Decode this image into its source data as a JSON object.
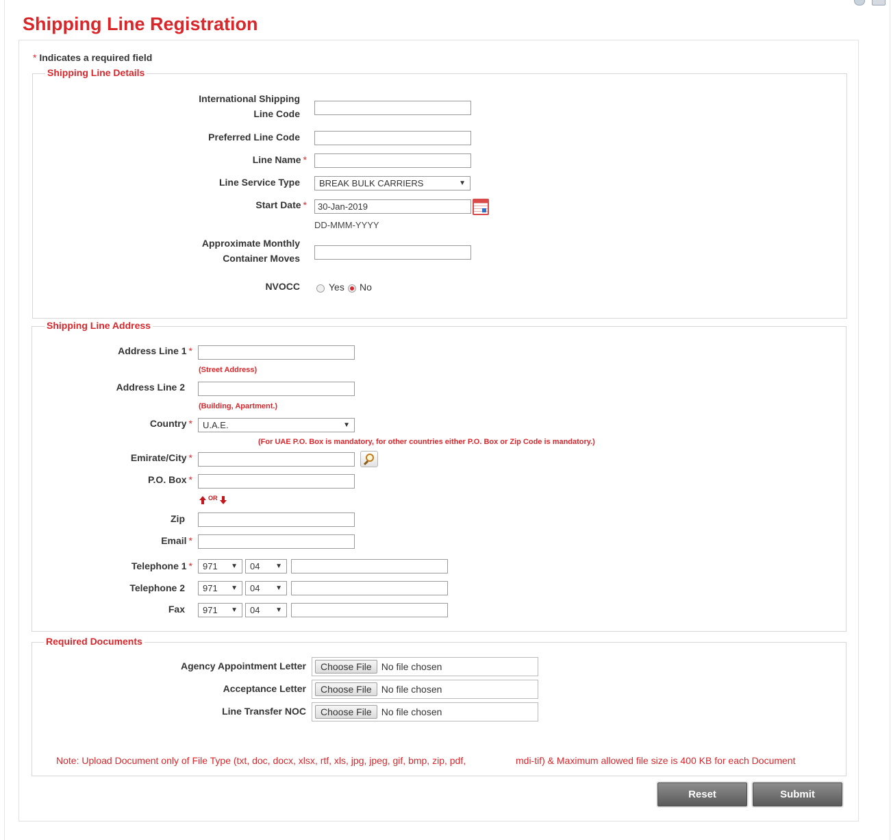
{
  "page": {
    "title": "Shipping Line Registration"
  },
  "required_note": {
    "star": "*",
    "text": "Indicates a required field"
  },
  "details": {
    "legend": "Shipping Line Details",
    "international_code_label_1": "International Shipping",
    "international_code_label_2": "Line Code",
    "international_code_value": "",
    "preferred_code_label": "Preferred Line Code",
    "preferred_code_value": "",
    "line_name_label": "Line Name",
    "line_name_value": "",
    "service_type_label": "Line Service Type",
    "service_type_value": "BREAK BULK CARRIERS",
    "start_date_label": "Start Date",
    "start_date_value": "30-Jan-2019",
    "date_format_hint": "DD-MMM-YYYY",
    "monthly_moves_label_1": "Approximate Monthly",
    "monthly_moves_label_2": "Container Moves",
    "monthly_moves_value": "",
    "nvocc_label": "NVOCC",
    "nvocc_yes": "Yes",
    "nvocc_no": "No",
    "nvocc_selected": "No"
  },
  "address": {
    "legend": "Shipping Line Address",
    "line1_label": "Address Line 1",
    "line1_hint": "(Street Address)",
    "line1_value": "",
    "line2_label": "Address Line 2",
    "line2_hint": "(Building, Apartment.)",
    "line2_value": "",
    "country_label": "Country",
    "country_value": "U.A.E.",
    "country_note": "(For UAE P.O. Box is mandatory, for other countries either P.O. Box or Zip Code is mandatory.)",
    "city_label": "Emirate/City",
    "city_value": "",
    "pobox_label": "P.O. Box",
    "pobox_value": "",
    "or_text": "OR",
    "zip_label": "Zip",
    "zip_value": "",
    "email_label": "Email",
    "email_value": "",
    "tel1_label": "Telephone 1",
    "tel1_country_code": "971",
    "tel1_area_code": "04",
    "tel1_number": "",
    "tel2_label": "Telephone 2",
    "tel2_country_code": "971",
    "tel2_area_code": "04",
    "tel2_number": "",
    "fax_label": "Fax",
    "fax_country_code": "971",
    "fax_area_code": "04",
    "fax_number": ""
  },
  "documents": {
    "legend": "Required Documents",
    "choose_file_label": "Choose File",
    "no_file_text": "No file chosen",
    "agency_letter_label": "Agency Appointment Letter",
    "acceptance_letter_label": "Acceptance Letter",
    "transfer_noc_label": "Line Transfer NOC",
    "note_part1": "Note: Upload Document only of File Type (txt, doc, docx, xlsx, rtf, xls, jpg, jpeg, gif, bmp, zip, pdf,",
    "note_part2": "mdi-tif) & Maximum allowed file size is 400 KB for each Document"
  },
  "actions": {
    "reset_label": "Reset",
    "submit_label": "Submit"
  },
  "icons": {
    "help": "help-icon",
    "print": "print-icon",
    "calendar": "calendar-icon",
    "search": "search-icon",
    "arrow_up": "arrow-up-icon",
    "arrow_down": "arrow-down-icon",
    "chevron_down": "chevron-down-icon"
  },
  "colors": {
    "accent_red": "#d9262b",
    "button_gray": "#6b6b6b"
  }
}
